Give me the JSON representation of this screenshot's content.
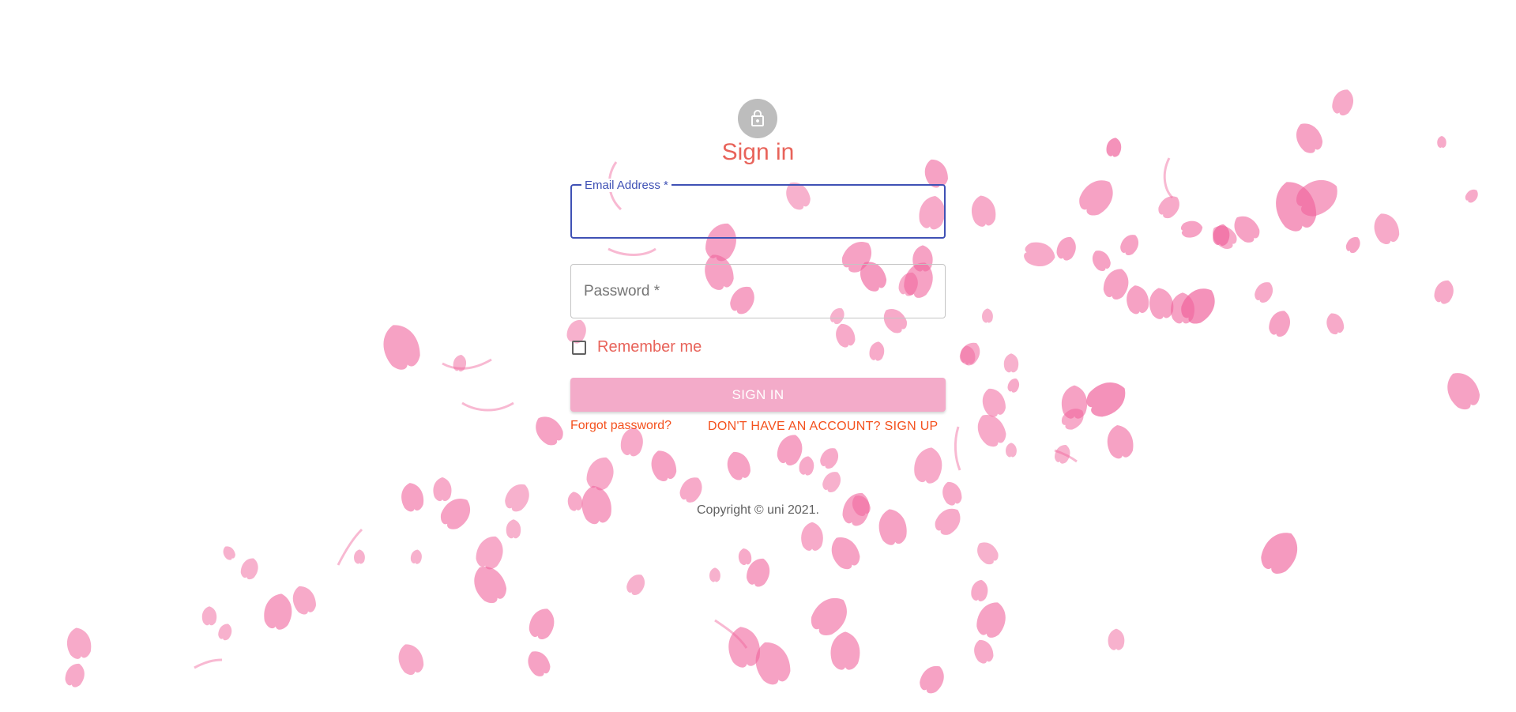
{
  "colors": {
    "title": "#e8635a",
    "focus_outline": "#3f51b5",
    "button_bg": "#f3abc9",
    "link": "#f4511e",
    "petal": "#f0649c",
    "avatar_bg": "#bdbdbd"
  },
  "header": {
    "avatar_icon": "lock-icon",
    "title": "Sign in"
  },
  "form": {
    "email": {
      "label": "Email Address *",
      "value": ""
    },
    "password": {
      "placeholder": "Password *",
      "value": ""
    },
    "remember": {
      "label": "Remember me",
      "checked": false
    },
    "submit_label": "Sign In"
  },
  "links": {
    "forgot": "Forgot password?",
    "signup": "DON'T HAVE AN ACCOUNT? SIGN UP"
  },
  "footer": {
    "copyright": "Copyright © uni 2021."
  },
  "background": {
    "decoration": "falling-petals"
  }
}
